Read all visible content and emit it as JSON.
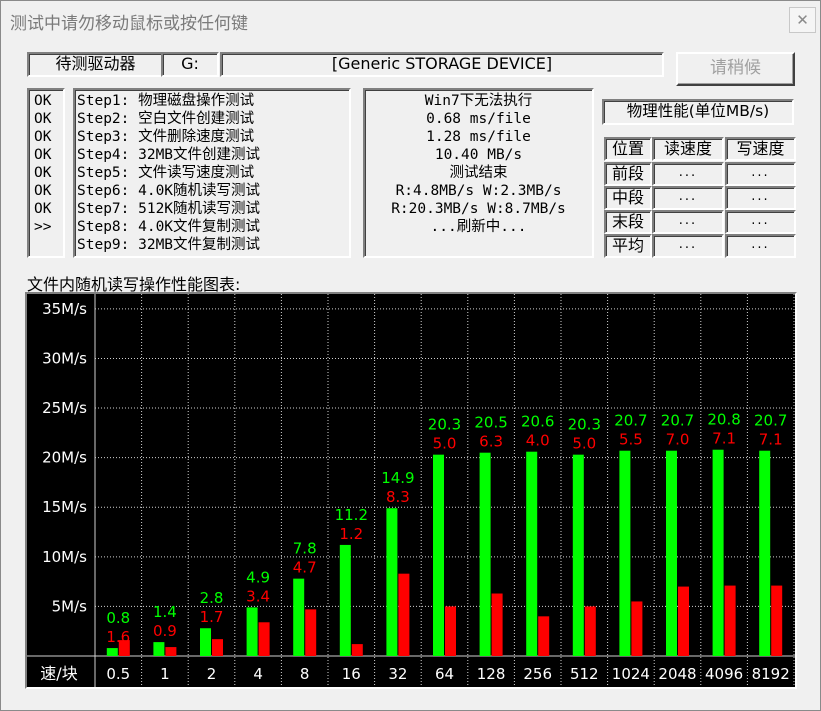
{
  "window": {
    "title": "测试中请勿移动鼠标或按任何键",
    "close_glyph": "✕"
  },
  "drive": {
    "label": "待测驱动器",
    "letter": "G:",
    "name": "[Generic STORAGE DEVICE]"
  },
  "wait_button": "请稍候",
  "status": [
    "OK",
    "OK",
    "OK",
    "OK",
    "OK",
    "OK",
    "OK",
    ">>"
  ],
  "steps": [
    "Step1: 物理磁盘操作测试",
    "Step2: 空白文件创建测试",
    "Step3: 文件删除速度测试",
    "Step4: 32MB文件创建测试",
    "Step5: 文件读写速度测试",
    "Step6: 4.0K随机读写测试",
    "Step7: 512K随机读写测试",
    "Step8: 4.0K文件复制测试",
    "Step9: 32MB文件复制测试"
  ],
  "results": [
    "Win7下无法执行",
    "0.68 ms/file",
    "1.28 ms/file",
    "10.40 MB/s",
    "测试结束",
    "R:4.8MB/s W:2.3MB/s",
    "R:20.3MB/s W:8.7MB/s",
    "...刷新中..."
  ],
  "physical": {
    "title": "物理性能(单位MB/s)",
    "headers": {
      "position": "位置",
      "read": "读速度",
      "write": "写速度"
    },
    "rows": [
      {
        "label": "前段",
        "read": "...",
        "write": "..."
      },
      {
        "label": "中段",
        "read": "...",
        "write": "..."
      },
      {
        "label": "末段",
        "read": "...",
        "write": "..."
      },
      {
        "label": "平均",
        "read": "...",
        "write": "..."
      }
    ]
  },
  "chart_caption": "文件内随机读写操作性能图表:",
  "chart_data": {
    "type": "bar",
    "xlabel": "速/块",
    "categories": [
      "0.5",
      "1",
      "2",
      "4",
      "8",
      "16",
      "32",
      "64",
      "128",
      "256",
      "512",
      "1024",
      "2048",
      "4096",
      "8192"
    ],
    "series": [
      {
        "values": [
          0.8,
          1.4,
          2.8,
          4.9,
          7.8,
          11.2,
          14.9,
          20.3,
          20.5,
          20.6,
          20.3,
          20.7,
          20.7,
          20.8,
          20.7
        ],
        "color": "#00ff00",
        "labels": [
          "0.8",
          "1.4",
          "2.8",
          "4.9",
          "7.8",
          "11.2",
          "14.9",
          "20.3",
          "20.5",
          "20.6",
          "20.3",
          "20.7",
          "20.7",
          "20.8",
          "20.7"
        ]
      },
      {
        "values": [
          1.6,
          0.9,
          1.7,
          3.4,
          4.7,
          1.2,
          8.3,
          5.0,
          6.3,
          4.0,
          5.0,
          5.5,
          7.0,
          7.1,
          7.1
        ],
        "color": "#ff0000",
        "labels": [
          "1.6",
          "0.9",
          "1.7",
          "3.4",
          "4.7",
          "1.2",
          "8.3",
          "5.0",
          "6.3",
          "4.0",
          "5.0",
          "5.5",
          "7.0",
          "7.1",
          "7.1"
        ]
      }
    ],
    "yticks": [
      "5M/s",
      "10M/s",
      "15M/s",
      "20M/s",
      "25M/s",
      "30M/s",
      "35M/s"
    ],
    "ytick_values": [
      5,
      10,
      15,
      20,
      25,
      30,
      35
    ],
    "ylim": [
      0,
      35
    ],
    "grid": true,
    "background": "#000000"
  }
}
